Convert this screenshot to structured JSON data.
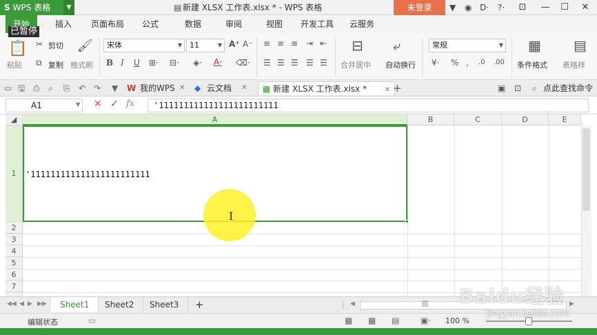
{
  "app": {
    "logo": "S",
    "name": "WPS 表格",
    "doc_title": "新建 XLSX 工作表.xlsx * - WPS 表格",
    "login": "未登录"
  },
  "overlay": {
    "paused": "已暂停"
  },
  "ribbon_tabs": [
    "开始",
    "插入",
    "页面布局",
    "公式",
    "数据",
    "审阅",
    "视图",
    "开发工具",
    "云服务"
  ],
  "ribbon": {
    "cut": "剪切",
    "copy": "复制",
    "paste": "粘贴",
    "format_painter": "格式刷",
    "font_name": "宋体",
    "font_size": "11",
    "merge_center": "合并居中",
    "wrap_text": "自动换行",
    "number_format": "常规",
    "conditional_format": "条件格式",
    "table_style": "表格样"
  },
  "doc_tabs": {
    "my_wps": "我的WPS",
    "cloud_docs": "云文档",
    "active_doc": "新建 XLSX 工作表.xlsx *",
    "find_command": "点此查找命令"
  },
  "formula_bar": {
    "cell_ref": "A1",
    "content": "'111111111111111111111111"
  },
  "grid": {
    "columns": [
      "A",
      "B",
      "C",
      "D",
      "E"
    ],
    "rows": [
      "1",
      "2",
      "3",
      "4",
      "5",
      "6",
      "7"
    ],
    "cell_a1": "'111111111111111111111111"
  },
  "sheets": [
    "Sheet1",
    "Sheet2",
    "Sheet3"
  ],
  "status": {
    "mode": "编辑状态",
    "zoom": "100 %"
  },
  "watermark": {
    "brand": "Baidu经验",
    "url": "jingyan.baidu.com"
  }
}
